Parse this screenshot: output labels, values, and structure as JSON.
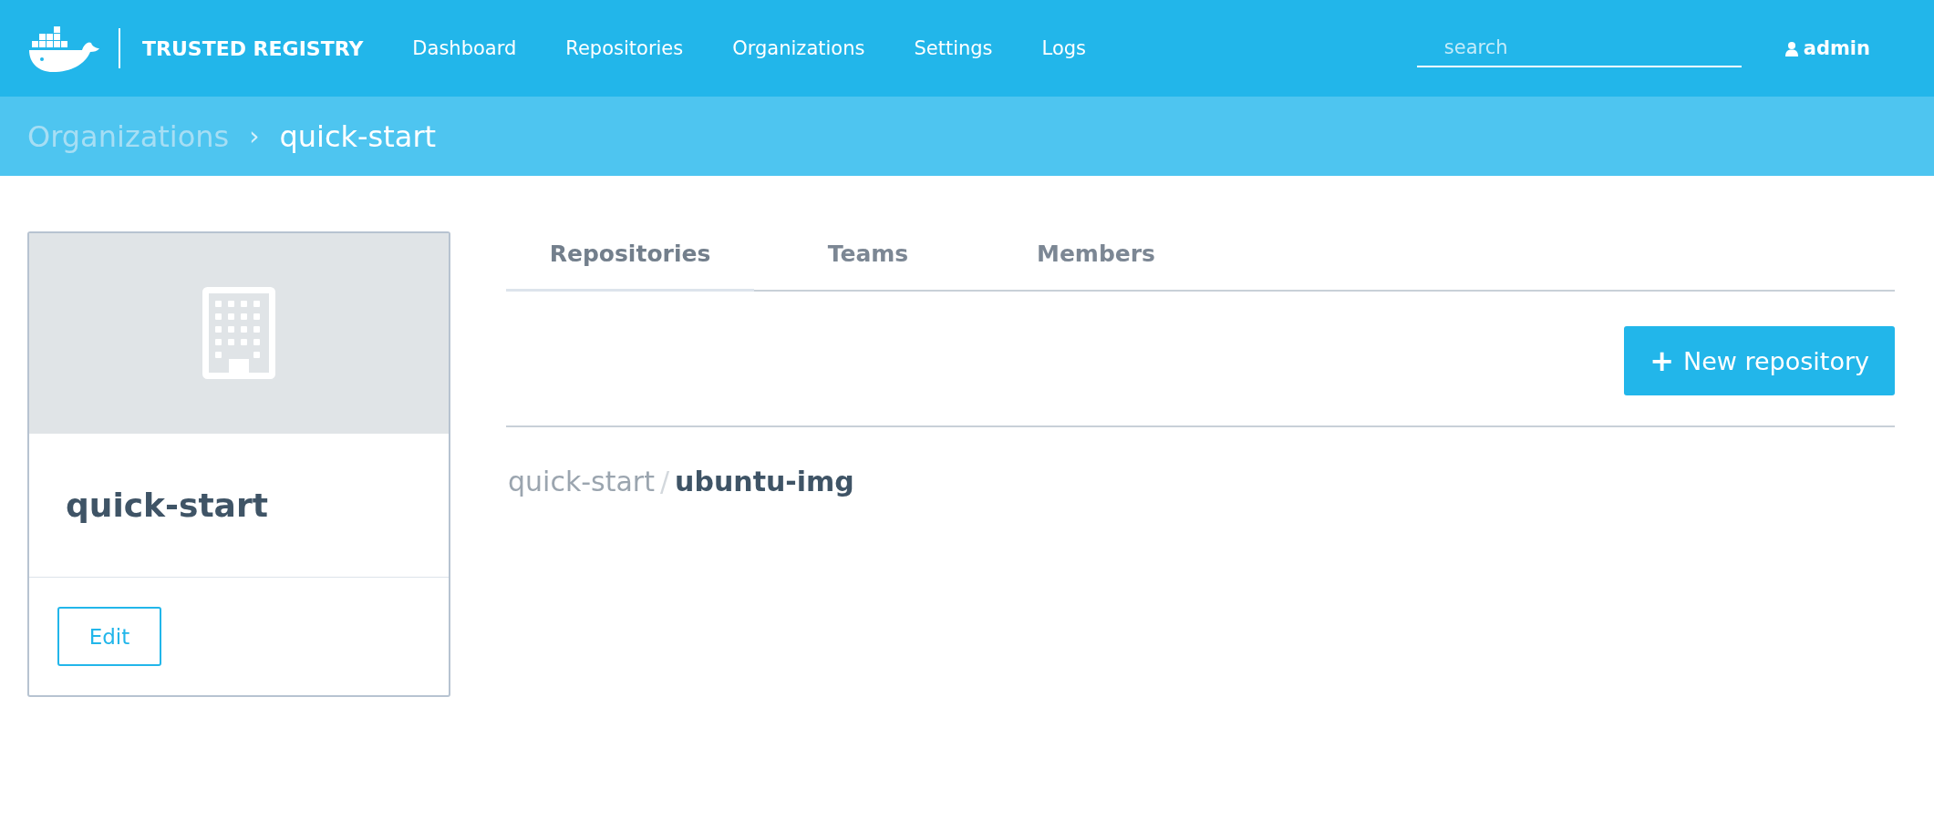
{
  "header": {
    "brand": "TRUSTED REGISTRY",
    "nav": [
      {
        "label": "Dashboard"
      },
      {
        "label": "Repositories"
      },
      {
        "label": "Organizations"
      },
      {
        "label": "Settings"
      },
      {
        "label": "Logs"
      }
    ],
    "search": {
      "placeholder": "search"
    },
    "user": "admin"
  },
  "breadcrumb": {
    "parent": "Organizations",
    "separator": "›",
    "current": "quick-start"
  },
  "org_card": {
    "name": "quick-start",
    "edit_button": "Edit"
  },
  "tabs": [
    {
      "label": "Repositories",
      "selected": true
    },
    {
      "label": "Teams",
      "selected": false
    },
    {
      "label": "Members",
      "selected": false
    }
  ],
  "new_repository_button": {
    "icon": "+",
    "label": "New repository"
  },
  "repositories": [
    {
      "namespace": "quick-start",
      "separator": "/",
      "name": "ubuntu-img"
    }
  ]
}
